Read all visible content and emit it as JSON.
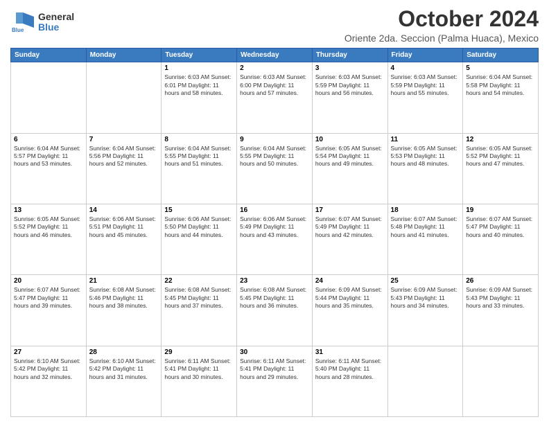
{
  "logo": {
    "general": "General",
    "blue": "Blue"
  },
  "title": "October 2024",
  "subtitle": "Oriente 2da. Seccion (Palma Huaca), Mexico",
  "days_of_week": [
    "Sunday",
    "Monday",
    "Tuesday",
    "Wednesday",
    "Thursday",
    "Friday",
    "Saturday"
  ],
  "weeks": [
    [
      {
        "day": "",
        "info": ""
      },
      {
        "day": "",
        "info": ""
      },
      {
        "day": "1",
        "info": "Sunrise: 6:03 AM\nSunset: 6:01 PM\nDaylight: 11 hours and 58 minutes."
      },
      {
        "day": "2",
        "info": "Sunrise: 6:03 AM\nSunset: 6:00 PM\nDaylight: 11 hours and 57 minutes."
      },
      {
        "day": "3",
        "info": "Sunrise: 6:03 AM\nSunset: 5:59 PM\nDaylight: 11 hours and 56 minutes."
      },
      {
        "day": "4",
        "info": "Sunrise: 6:03 AM\nSunset: 5:59 PM\nDaylight: 11 hours and 55 minutes."
      },
      {
        "day": "5",
        "info": "Sunrise: 6:04 AM\nSunset: 5:58 PM\nDaylight: 11 hours and 54 minutes."
      }
    ],
    [
      {
        "day": "6",
        "info": "Sunrise: 6:04 AM\nSunset: 5:57 PM\nDaylight: 11 hours and 53 minutes."
      },
      {
        "day": "7",
        "info": "Sunrise: 6:04 AM\nSunset: 5:56 PM\nDaylight: 11 hours and 52 minutes."
      },
      {
        "day": "8",
        "info": "Sunrise: 6:04 AM\nSunset: 5:55 PM\nDaylight: 11 hours and 51 minutes."
      },
      {
        "day": "9",
        "info": "Sunrise: 6:04 AM\nSunset: 5:55 PM\nDaylight: 11 hours and 50 minutes."
      },
      {
        "day": "10",
        "info": "Sunrise: 6:05 AM\nSunset: 5:54 PM\nDaylight: 11 hours and 49 minutes."
      },
      {
        "day": "11",
        "info": "Sunrise: 6:05 AM\nSunset: 5:53 PM\nDaylight: 11 hours and 48 minutes."
      },
      {
        "day": "12",
        "info": "Sunrise: 6:05 AM\nSunset: 5:52 PM\nDaylight: 11 hours and 47 minutes."
      }
    ],
    [
      {
        "day": "13",
        "info": "Sunrise: 6:05 AM\nSunset: 5:52 PM\nDaylight: 11 hours and 46 minutes."
      },
      {
        "day": "14",
        "info": "Sunrise: 6:06 AM\nSunset: 5:51 PM\nDaylight: 11 hours and 45 minutes."
      },
      {
        "day": "15",
        "info": "Sunrise: 6:06 AM\nSunset: 5:50 PM\nDaylight: 11 hours and 44 minutes."
      },
      {
        "day": "16",
        "info": "Sunrise: 6:06 AM\nSunset: 5:49 PM\nDaylight: 11 hours and 43 minutes."
      },
      {
        "day": "17",
        "info": "Sunrise: 6:07 AM\nSunset: 5:49 PM\nDaylight: 11 hours and 42 minutes."
      },
      {
        "day": "18",
        "info": "Sunrise: 6:07 AM\nSunset: 5:48 PM\nDaylight: 11 hours and 41 minutes."
      },
      {
        "day": "19",
        "info": "Sunrise: 6:07 AM\nSunset: 5:47 PM\nDaylight: 11 hours and 40 minutes."
      }
    ],
    [
      {
        "day": "20",
        "info": "Sunrise: 6:07 AM\nSunset: 5:47 PM\nDaylight: 11 hours and 39 minutes."
      },
      {
        "day": "21",
        "info": "Sunrise: 6:08 AM\nSunset: 5:46 PM\nDaylight: 11 hours and 38 minutes."
      },
      {
        "day": "22",
        "info": "Sunrise: 6:08 AM\nSunset: 5:45 PM\nDaylight: 11 hours and 37 minutes."
      },
      {
        "day": "23",
        "info": "Sunrise: 6:08 AM\nSunset: 5:45 PM\nDaylight: 11 hours and 36 minutes."
      },
      {
        "day": "24",
        "info": "Sunrise: 6:09 AM\nSunset: 5:44 PM\nDaylight: 11 hours and 35 minutes."
      },
      {
        "day": "25",
        "info": "Sunrise: 6:09 AM\nSunset: 5:43 PM\nDaylight: 11 hours and 34 minutes."
      },
      {
        "day": "26",
        "info": "Sunrise: 6:09 AM\nSunset: 5:43 PM\nDaylight: 11 hours and 33 minutes."
      }
    ],
    [
      {
        "day": "27",
        "info": "Sunrise: 6:10 AM\nSunset: 5:42 PM\nDaylight: 11 hours and 32 minutes."
      },
      {
        "day": "28",
        "info": "Sunrise: 6:10 AM\nSunset: 5:42 PM\nDaylight: 11 hours and 31 minutes."
      },
      {
        "day": "29",
        "info": "Sunrise: 6:11 AM\nSunset: 5:41 PM\nDaylight: 11 hours and 30 minutes."
      },
      {
        "day": "30",
        "info": "Sunrise: 6:11 AM\nSunset: 5:41 PM\nDaylight: 11 hours and 29 minutes."
      },
      {
        "day": "31",
        "info": "Sunrise: 6:11 AM\nSunset: 5:40 PM\nDaylight: 11 hours and 28 minutes."
      },
      {
        "day": "",
        "info": ""
      },
      {
        "day": "",
        "info": ""
      }
    ]
  ]
}
